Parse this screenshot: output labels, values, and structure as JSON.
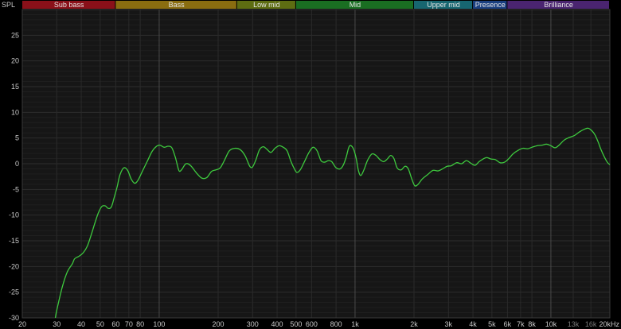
{
  "chart_data": {
    "type": "line",
    "ylabel": "SPL",
    "x_scale": "log",
    "xlim": [
      20,
      20000
    ],
    "ylim": [
      -30,
      30
    ],
    "grid": true,
    "y_ticks": [
      25,
      20,
      15,
      10,
      5,
      0,
      -5,
      -10,
      -15,
      -20,
      -25,
      -30
    ],
    "x_ticks": [
      {
        "value": 20,
        "label": "20"
      },
      {
        "value": 30,
        "label": "30"
      },
      {
        "value": 40,
        "label": "40"
      },
      {
        "value": 50,
        "label": "50"
      },
      {
        "value": 60,
        "label": "60"
      },
      {
        "value": 70,
        "label": "70"
      },
      {
        "value": 80,
        "label": "80"
      },
      {
        "value": 100,
        "label": "100"
      },
      {
        "value": 200,
        "label": "200"
      },
      {
        "value": 300,
        "label": "300"
      },
      {
        "value": 400,
        "label": "400"
      },
      {
        "value": 500,
        "label": "500"
      },
      {
        "value": 600,
        "label": "600"
      },
      {
        "value": 800,
        "label": "800"
      },
      {
        "value": 1000,
        "label": "1k"
      },
      {
        "value": 2000,
        "label": "2k"
      },
      {
        "value": 3000,
        "label": "3k"
      },
      {
        "value": 4000,
        "label": "4k"
      },
      {
        "value": 5000,
        "label": "5k"
      },
      {
        "value": 6000,
        "label": "6k"
      },
      {
        "value": 7000,
        "label": "7k"
      },
      {
        "value": 8000,
        "label": "8k"
      },
      {
        "value": 10000,
        "label": "10k"
      },
      {
        "value": 13000,
        "label": "13k",
        "dim": true
      },
      {
        "value": 16000,
        "label": "16k",
        "dim": true
      },
      {
        "value": 20000,
        "label": "20kHz"
      }
    ],
    "bands": [
      {
        "label": "Sub bass",
        "from": 20,
        "to": 60,
        "color": "#8a1019"
      },
      {
        "label": "Bass",
        "from": 60,
        "to": 250,
        "color": "#8a6d10"
      },
      {
        "label": "Low mid",
        "from": 250,
        "to": 500,
        "color": "#5e6d12"
      },
      {
        "label": "Mid",
        "from": 500,
        "to": 2000,
        "color": "#1a6e22"
      },
      {
        "label": "Upper mid",
        "from": 2000,
        "to": 4000,
        "color": "#176670"
      },
      {
        "label": "Presence",
        "from": 4000,
        "to": 6000,
        "color": "#1a3f80"
      },
      {
        "label": "Brilliance",
        "from": 6000,
        "to": 20000,
        "color": "#4a2470"
      }
    ],
    "series": [
      {
        "color": "#3ec93e",
        "points": [
          [
            29.5,
            -30
          ],
          [
            30,
            -28.5
          ],
          [
            32,
            -24
          ],
          [
            34,
            -21
          ],
          [
            36,
            -19.5
          ],
          [
            37,
            -18.5
          ],
          [
            39,
            -18
          ],
          [
            41,
            -17.3
          ],
          [
            43,
            -16
          ],
          [
            45,
            -13.8
          ],
          [
            47,
            -11.5
          ],
          [
            49,
            -9.5
          ],
          [
            51,
            -8.3
          ],
          [
            53,
            -8.2
          ],
          [
            55,
            -8.7
          ],
          [
            57,
            -8.4
          ],
          [
            59,
            -6.5
          ],
          [
            61,
            -4.5
          ],
          [
            63,
            -2.2
          ],
          [
            66,
            -0.8
          ],
          [
            69,
            -1.3
          ],
          [
            72,
            -3
          ],
          [
            75,
            -3.8
          ],
          [
            78,
            -3.2
          ],
          [
            82,
            -1.5
          ],
          [
            87,
            0.5
          ],
          [
            92,
            2.4
          ],
          [
            97,
            3.4
          ],
          [
            101,
            3.6
          ],
          [
            106,
            3.2
          ],
          [
            111,
            3.4
          ],
          [
            116,
            3.1
          ],
          [
            121,
            1.2
          ],
          [
            126,
            -1.3
          ],
          [
            130,
            -1.2
          ],
          [
            137,
            0
          ],
          [
            145,
            -0.4
          ],
          [
            155,
            -1.8
          ],
          [
            165,
            -2.8
          ],
          [
            175,
            -2.7
          ],
          [
            185,
            -1.5
          ],
          [
            195,
            -1.2
          ],
          [
            205,
            -0.8
          ],
          [
            215,
            0.6
          ],
          [
            228,
            2.5
          ],
          [
            243,
            3
          ],
          [
            260,
            2.7
          ],
          [
            275,
            1.5
          ],
          [
            290,
            -0.5
          ],
          [
            300,
            -0.6
          ],
          [
            312,
            0.8
          ],
          [
            325,
            2.7
          ],
          [
            340,
            3.3
          ],
          [
            355,
            2.8
          ],
          [
            372,
            2.2
          ],
          [
            390,
            3
          ],
          [
            410,
            3.5
          ],
          [
            430,
            3.2
          ],
          [
            450,
            2.5
          ],
          [
            470,
            0.5
          ],
          [
            490,
            -1
          ],
          [
            505,
            -1.7
          ],
          [
            525,
            -1.2
          ],
          [
            550,
            0.3
          ],
          [
            580,
            2.1
          ],
          [
            610,
            3.2
          ],
          [
            640,
            2.5
          ],
          [
            670,
            0.6
          ],
          [
            700,
            0.3
          ],
          [
            730,
            0.6
          ],
          [
            760,
            0.4
          ],
          [
            800,
            -0.8
          ],
          [
            840,
            -1
          ],
          [
            870,
            -0.3
          ],
          [
            900,
            1.2
          ],
          [
            935,
            3.4
          ],
          [
            975,
            3.1
          ],
          [
            1010,
            1.3
          ],
          [
            1040,
            -1.3
          ],
          [
            1070,
            -2.3
          ],
          [
            1110,
            -1.2
          ],
          [
            1160,
            0.7
          ],
          [
            1220,
            1.9
          ],
          [
            1280,
            1.6
          ],
          [
            1340,
            0.8
          ],
          [
            1400,
            0.4
          ],
          [
            1460,
            0.9
          ],
          [
            1520,
            1.6
          ],
          [
            1580,
            1
          ],
          [
            1640,
            -0.8
          ],
          [
            1720,
            -1.2
          ],
          [
            1800,
            -0.5
          ],
          [
            1870,
            -1
          ],
          [
            1950,
            -3
          ],
          [
            2020,
            -4.3
          ],
          [
            2100,
            -4
          ],
          [
            2200,
            -3
          ],
          [
            2350,
            -2.1
          ],
          [
            2500,
            -1.3
          ],
          [
            2650,
            -1.4
          ],
          [
            2800,
            -1
          ],
          [
            2950,
            -0.5
          ],
          [
            3100,
            -0.4
          ],
          [
            3300,
            0.2
          ],
          [
            3500,
            0
          ],
          [
            3700,
            0.6
          ],
          [
            3900,
            0.1
          ],
          [
            4100,
            -0.3
          ],
          [
            4300,
            0.4
          ],
          [
            4500,
            0.9
          ],
          [
            4700,
            1.2
          ],
          [
            4950,
            0.9
          ],
          [
            5200,
            0.8
          ],
          [
            5500,
            0.2
          ],
          [
            5800,
            0.3
          ],
          [
            6100,
            1
          ],
          [
            6400,
            1.9
          ],
          [
            6800,
            2.6
          ],
          [
            7200,
            3
          ],
          [
            7600,
            2.9
          ],
          [
            8000,
            3.2
          ],
          [
            8500,
            3.5
          ],
          [
            9000,
            3.6
          ],
          [
            9500,
            3.8
          ],
          [
            10000,
            3.5
          ],
          [
            10500,
            3.1
          ],
          [
            11000,
            3.6
          ],
          [
            11700,
            4.6
          ],
          [
            12400,
            5.1
          ],
          [
            13200,
            5.5
          ],
          [
            14000,
            6.2
          ],
          [
            14800,
            6.7
          ],
          [
            15500,
            6.9
          ],
          [
            16200,
            6.4
          ],
          [
            16800,
            5.6
          ],
          [
            17400,
            4.3
          ],
          [
            18000,
            2.8
          ],
          [
            18700,
            1.4
          ],
          [
            19400,
            0.3
          ],
          [
            20000,
            -0.2
          ]
        ]
      }
    ]
  }
}
